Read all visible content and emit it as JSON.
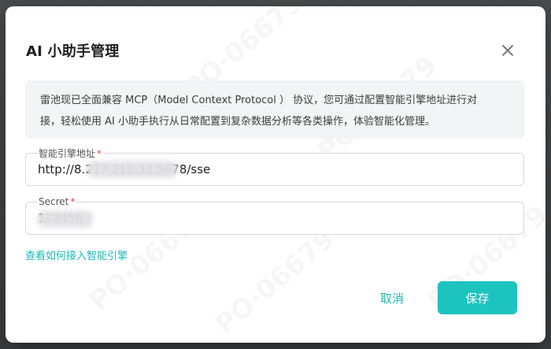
{
  "dialog": {
    "title": "AI 小助手管理",
    "notice_line1": "雷池现已全面兼容 MCP（Model Context Protocol ） 协议，您可通过配置智能引擎地址进行对",
    "notice_line2": "接，轻松使用 AI 小助手执行从日常配置到复杂数据分析等各类操作，体验智能化管理。",
    "fields": {
      "engine_address": {
        "label": "智能引擎地址",
        "required_mark": "*",
        "value": "http://8.217.212.33:5678/sse"
      },
      "secret": {
        "label": "Secret",
        "required_mark": "*",
        "value": "123456"
      }
    },
    "help_link": "查看如何接入智能引擎",
    "cancel_label": "取消",
    "save_label": "保存",
    "close_icon": "close-icon",
    "accent_color": "#1dc3bf",
    "required_color": "#e0433a"
  }
}
